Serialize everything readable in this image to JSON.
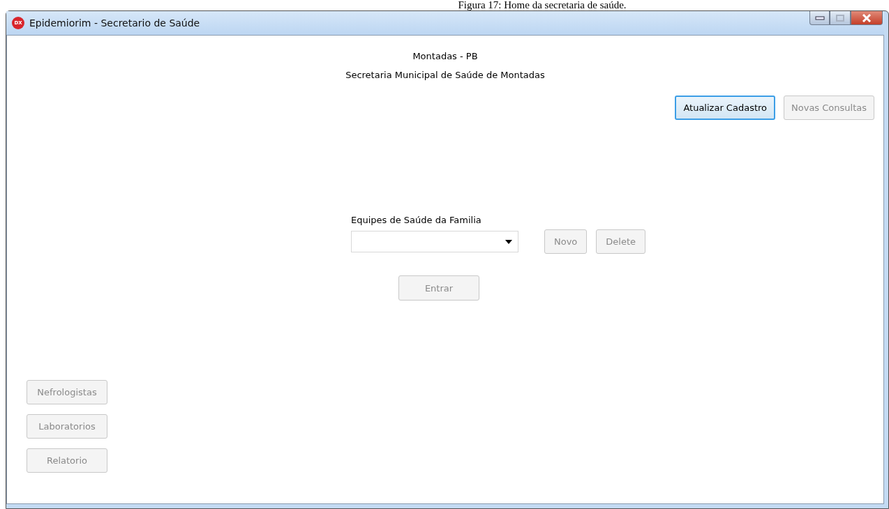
{
  "caption": "Figura 17: Home da secretaria de saúde.",
  "window": {
    "title": "Epidemiorim - Secretario de Saúde",
    "app_icon": "DX"
  },
  "header": {
    "city": "Montadas - PB",
    "organization": "Secretaria Municipal de Saúde de Montadas"
  },
  "top_buttons": [
    {
      "label": "Atualizar Cadastro",
      "disabled": false,
      "focused": true
    },
    {
      "label": "Novas Consultas",
      "disabled": true,
      "focused": false
    }
  ],
  "team_selector": {
    "label": "Equipes de Saúde da Familia",
    "buttons": [
      {
        "label": "Novo",
        "disabled": true,
        "focused": false
      },
      {
        "label": "Delete",
        "disabled": true,
        "focused": false
      }
    ]
  },
  "enter_button": {
    "label": "Entrar",
    "disabled": true,
    "focused": false
  },
  "side_buttons": [
    {
      "label": "Nefrologistas",
      "disabled": true,
      "focused": false
    },
    {
      "label": "Laboratorios",
      "disabled": true,
      "focused": false
    },
    {
      "label": "Relatorio",
      "disabled": true,
      "focused": false
    }
  ]
}
